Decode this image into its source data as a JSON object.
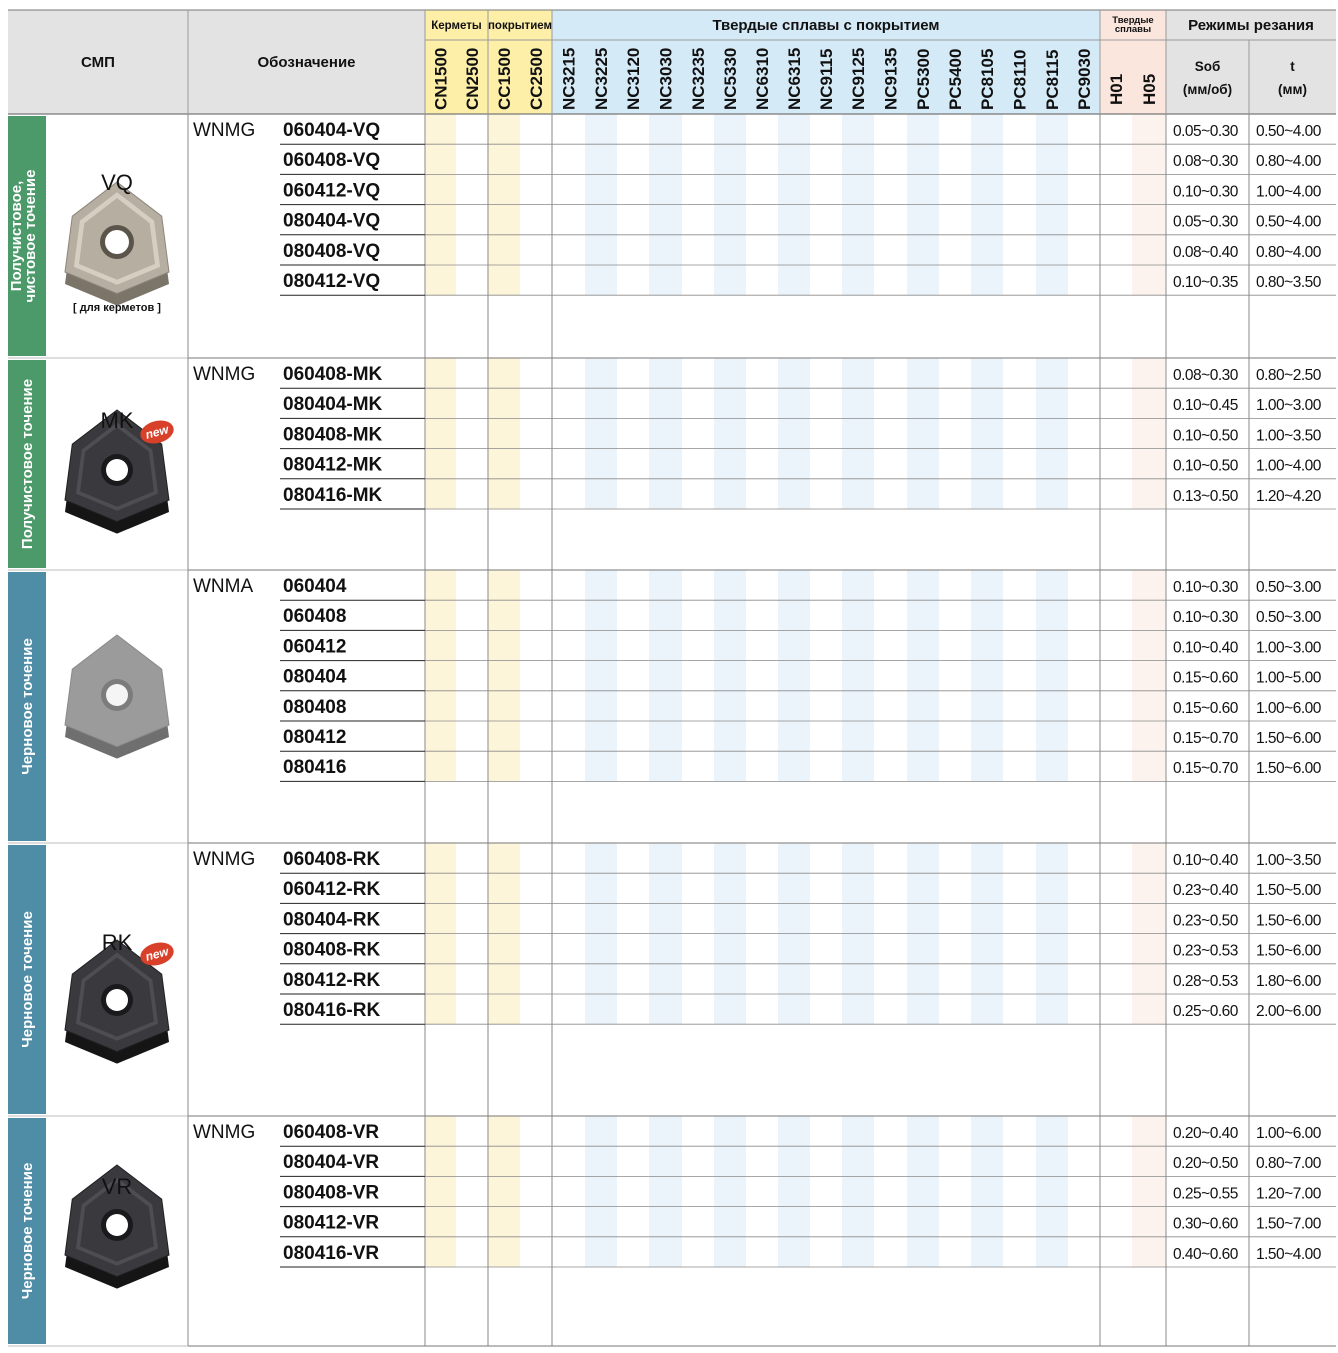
{
  "header": {
    "smp": "СМП",
    "designation": "Обозначение",
    "group_cermets": "Керметы",
    "group_coated_cermets": "покрытием",
    "group_coated_carbides": "Твердые сплавы с покрытием",
    "group_carbides": "Твердые сплавы",
    "group_cutting": "Режимы резания",
    "col_feed": "Sоб",
    "col_feed_unit": "(мм/об)",
    "col_depth": "t",
    "col_depth_unit": "(мм)"
  },
  "grades": [
    "CN1500",
    "CN2500",
    "CC1500",
    "CC2500",
    "NC3215",
    "NC3225",
    "NC3120",
    "NC3030",
    "NC3235",
    "NC5330",
    "NC6310",
    "NC6315",
    "NC9115",
    "NC9125",
    "NC9135",
    "PC5300",
    "PC5400",
    "PC8105",
    "PC8110",
    "PC8115",
    "PC9030",
    "H01",
    "H05"
  ],
  "sections": [
    {
      "side_label": [
        "Получистовое,",
        "чистовое точение"
      ],
      "insert_label": "VQ",
      "note": "[ для керметов ]",
      "is_new": false,
      "prefix": "WNMG",
      "rows": [
        {
          "code": "060404-VQ",
          "feed": "0.05~0.30",
          "depth": "0.50~4.00"
        },
        {
          "code": "060408-VQ",
          "feed": "0.08~0.30",
          "depth": "0.80~4.00"
        },
        {
          "code": "060412-VQ",
          "feed": "0.10~0.30",
          "depth": "1.00~4.00"
        },
        {
          "code": "080404-VQ",
          "feed": "0.05~0.30",
          "depth": "0.50~4.00"
        },
        {
          "code": "080408-VQ",
          "feed": "0.08~0.40",
          "depth": "0.80~4.00"
        },
        {
          "code": "080412-VQ",
          "feed": "0.10~0.35",
          "depth": "0.80~3.50"
        }
      ]
    },
    {
      "side_label": [
        "Получистовое точение"
      ],
      "insert_label": "MK",
      "note": "",
      "is_new": true,
      "prefix": "WNMG",
      "rows": [
        {
          "code": "060408-MK",
          "feed": "0.08~0.30",
          "depth": "0.80~2.50"
        },
        {
          "code": "080404-MK",
          "feed": "0.10~0.45",
          "depth": "1.00~3.00"
        },
        {
          "code": "080408-MK",
          "feed": "0.10~0.50",
          "depth": "1.00~3.50"
        },
        {
          "code": "080412-MK",
          "feed": "0.10~0.50",
          "depth": "1.00~4.00"
        },
        {
          "code": "080416-MK",
          "feed": "0.13~0.50",
          "depth": "1.20~4.20"
        }
      ]
    },
    {
      "side_label": [
        "Черновое точение"
      ],
      "insert_label": "",
      "note": "",
      "is_new": false,
      "prefix": "WNMA",
      "rows": [
        {
          "code": "060404",
          "feed": "0.10~0.30",
          "depth": "0.50~3.00"
        },
        {
          "code": "060408",
          "feed": "0.10~0.30",
          "depth": "0.50~3.00"
        },
        {
          "code": "060412",
          "feed": "0.10~0.40",
          "depth": "1.00~3.00"
        },
        {
          "code": "080404",
          "feed": "0.15~0.60",
          "depth": "1.00~5.00"
        },
        {
          "code": "080408",
          "feed": "0.15~0.60",
          "depth": "1.00~6.00"
        },
        {
          "code": "080412",
          "feed": "0.15~0.70",
          "depth": "1.50~6.00"
        },
        {
          "code": "080416",
          "feed": "0.15~0.70",
          "depth": "1.50~6.00"
        }
      ]
    },
    {
      "side_label": [
        "Черновое точение"
      ],
      "insert_label": "RK",
      "note": "",
      "is_new": true,
      "prefix": "WNMG",
      "rows": [
        {
          "code": "060408-RK",
          "feed": "0.10~0.40",
          "depth": "1.00~3.50"
        },
        {
          "code": "060412-RK",
          "feed": "0.23~0.40",
          "depth": "1.50~5.00"
        },
        {
          "code": "080404-RK",
          "feed": "0.23~0.50",
          "depth": "1.50~6.00"
        },
        {
          "code": "080408-RK",
          "feed": "0.23~0.53",
          "depth": "1.50~6.00"
        },
        {
          "code": "080412-RK",
          "feed": "0.28~0.53",
          "depth": "1.80~6.00"
        },
        {
          "code": "080416-RK",
          "feed": "0.25~0.60",
          "depth": "2.00~6.00"
        }
      ]
    },
    {
      "side_label": [
        "Черновое точение"
      ],
      "insert_label": "VR",
      "note": "",
      "is_new": false,
      "prefix": "WNMG",
      "rows": [
        {
          "code": "060408-VR",
          "feed": "0.20~0.40",
          "depth": "1.00~6.00"
        },
        {
          "code": "080404-VR",
          "feed": "0.20~0.50",
          "depth": "0.80~7.00"
        },
        {
          "code": "080408-VR",
          "feed": "0.25~0.55",
          "depth": "1.20~7.00"
        },
        {
          "code": "080412-VR",
          "feed": "0.30~0.60",
          "depth": "1.50~7.00"
        },
        {
          "code": "080416-VR",
          "feed": "0.40~0.60",
          "depth": "1.50~4.00"
        }
      ]
    }
  ],
  "new_badge": "new",
  "colors": {
    "header_bg": "#e3e3e3",
    "cermet_hdr": "#fdefa8",
    "cermet_fill": "#fdf5d9",
    "coated_hdr": "#d5eaf7",
    "coated_fill": "#ecf4fb",
    "carbide_hdr": "#fbe6de",
    "carbide_fill": "#fdf3ee",
    "side_green": "#4c9a6a",
    "side_blue": "#4f8ca6",
    "badge_red": "#d8402a"
  }
}
